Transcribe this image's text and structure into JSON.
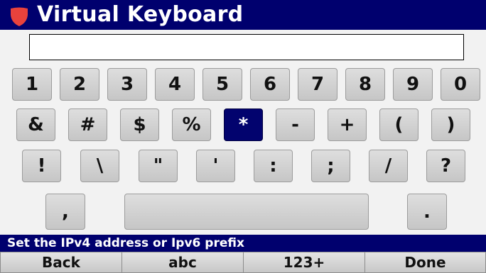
{
  "title": "Virtual Keyboard",
  "input": {
    "value": ""
  },
  "rows": [
    [
      "1",
      "2",
      "3",
      "4",
      "5",
      "6",
      "7",
      "8",
      "9",
      "0"
    ],
    [
      "&",
      "#",
      "$",
      "%",
      "*",
      "-",
      "+",
      "(",
      ")"
    ],
    [
      "!",
      "\\",
      "\"",
      "'",
      ":",
      ";",
      "/",
      "?"
    ],
    [
      ",",
      "",
      ".",
      ""
    ]
  ],
  "selected_key": "*",
  "status_text": "Set the IPv4 address or Ipv6 prefix",
  "softkeys": [
    "Back",
    "abc",
    "123+",
    "Done"
  ],
  "colors": {
    "accent": "#00006e",
    "selected_key": "#02036e",
    "logo": "#e8423c"
  }
}
